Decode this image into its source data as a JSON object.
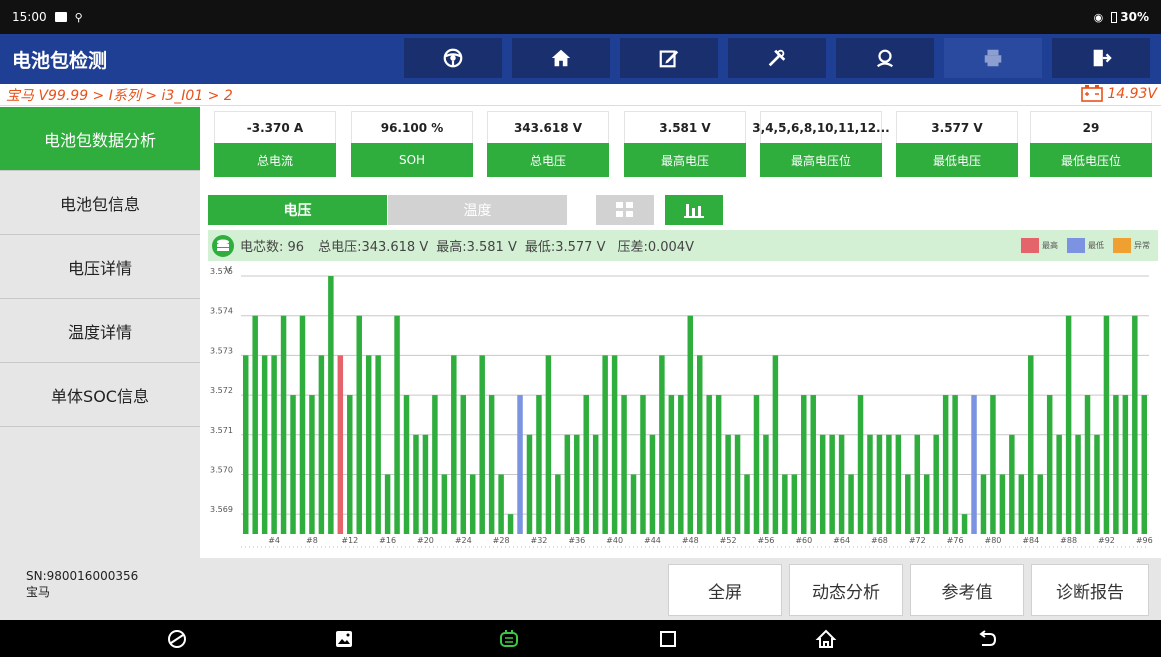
{
  "statusbar": {
    "time": "15:00",
    "battery": "30%"
  },
  "header": {
    "title": "电池包检测"
  },
  "toolbar": {
    "icons": [
      "steering-wheel-icon",
      "home-icon",
      "edit-icon",
      "tools-icon",
      "support-icon",
      "print-icon",
      "exit-icon"
    ]
  },
  "breadcrumb": {
    "path": "宝马 V99.99 > I系列 > i3_I01 > 2",
    "voltage": "14.93V"
  },
  "sidebar": {
    "items": [
      {
        "label": "电池包数据分析",
        "active": true
      },
      {
        "label": "电池包信息"
      },
      {
        "label": "电压详情"
      },
      {
        "label": "温度详情"
      },
      {
        "label": "单体SOC信息"
      }
    ]
  },
  "metrics": [
    {
      "value": "-3.370 A",
      "label": "总电流"
    },
    {
      "value": "96.100 %",
      "label": "SOH"
    },
    {
      "value": "343.618 V",
      "label": "总电压"
    },
    {
      "value": "3.581 V",
      "label": "最高电压"
    },
    {
      "value": "3,4,5,6,8,10,11,12...",
      "label": "最高电压位"
    },
    {
      "value": "3.577 V",
      "label": "最低电压"
    },
    {
      "value": "29",
      "label": "最低电压位"
    }
  ],
  "tabs": {
    "voltage": "电压",
    "temperature": "温度"
  },
  "summary": {
    "cells": "电芯数: 96",
    "total": "总电压:343.618 V",
    "max": "最高:3.581 V",
    "min": "最低:3.577 V",
    "diff": "压差:0.004V"
  },
  "legend": {
    "max": "最高",
    "min": "最低",
    "abnormal": "异常"
  },
  "colors": {
    "accent": "#2fad3d",
    "header": "#1f3f95",
    "max": "#e5636b",
    "min": "#7b93e0",
    "abnormal": "#f0a030"
  },
  "chart_data": {
    "type": "bar",
    "ylabel": "V",
    "ylim": [
      3.5685,
      3.575
    ],
    "yticks": [
      "3.569",
      "3.570",
      "3.571",
      "3.572",
      "3.573",
      "3.574",
      "3.575"
    ],
    "xticks": [
      "#4",
      "#8",
      "#12",
      "#16",
      "#20",
      "#24",
      "#28",
      "#32",
      "#36",
      "#40",
      "#44",
      "#48",
      "#52",
      "#56",
      "#60",
      "#64",
      "#68",
      "#72",
      "#76",
      "#80",
      "#84",
      "#88",
      "#92",
      "#96"
    ],
    "values": [
      3.573,
      3.574,
      3.573,
      3.573,
      3.574,
      3.572,
      3.574,
      3.572,
      3.573,
      3.575,
      3.573,
      3.572,
      3.574,
      3.573,
      3.573,
      3.57,
      3.574,
      3.572,
      3.571,
      3.571,
      3.572,
      3.57,
      3.573,
      3.572,
      3.57,
      3.573,
      3.572,
      3.57,
      3.569,
      3.572,
      3.571,
      3.572,
      3.573,
      3.57,
      3.571,
      3.571,
      3.572,
      3.571,
      3.573,
      3.573,
      3.572,
      3.57,
      3.572,
      3.571,
      3.573,
      3.572,
      3.572,
      3.574,
      3.573,
      3.572,
      3.572,
      3.571,
      3.571,
      3.57,
      3.572,
      3.571,
      3.573,
      3.57,
      3.57,
      3.572,
      3.572,
      3.571,
      3.571,
      3.571,
      3.57,
      3.572,
      3.571,
      3.571,
      3.571,
      3.571,
      3.57,
      3.571,
      3.57,
      3.571,
      3.572,
      3.572,
      3.569,
      3.572,
      3.57,
      3.572,
      3.57,
      3.571,
      3.57,
      3.573,
      3.57,
      3.572,
      3.571,
      3.574,
      3.571,
      3.572,
      3.571,
      3.574,
      3.572,
      3.572,
      3.574,
      3.572
    ],
    "max_index": 10,
    "min_indices": [
      29,
      77
    ]
  },
  "bottombar": {
    "sn": "SN:980016000356",
    "brand": "宝马",
    "buttons": [
      "全屏",
      "动态分析",
      "参考值",
      "诊断报告"
    ]
  }
}
